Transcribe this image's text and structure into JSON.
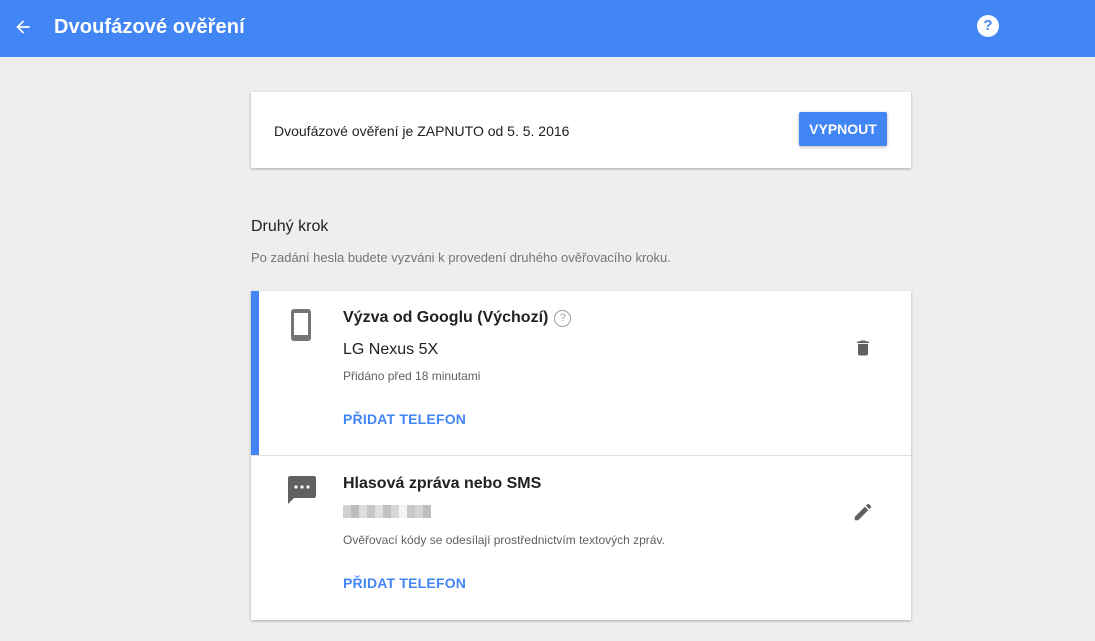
{
  "appbar": {
    "title": "Dvoufázové ověření",
    "back_icon": "arrow-back-icon",
    "help_icon": "help-icon",
    "help_glyph": "?",
    "color": "#4285f4"
  },
  "status": {
    "text": "Dvoufázové ověření je ZAPNUTO od 5. 5. 2016",
    "button_label": "VYPNOUT"
  },
  "second_step": {
    "title": "Druhý krok",
    "description": "Po zadání hesla budete vyzváni k provedení druhého ověřovacího kroku."
  },
  "methods": [
    {
      "icon": "smartphone-icon",
      "title_prefix": "Výzva od Googlu (",
      "title_default": "Výchozí",
      "title_suffix": ")",
      "help_glyph": "?",
      "device": "LG Nexus 5X",
      "detail": "Přidáno před 18 minutami",
      "link": "PŘIDAT TELEFON",
      "action_icon": "delete-icon",
      "active": true
    },
    {
      "icon": "sms-icon",
      "title": "Hlasová zpráva nebo SMS",
      "detail": "Ověřovací kódy se odesílají prostřednictvím textových zpráv.",
      "link": "PŘIDAT TELEFON",
      "action_icon": "edit-icon",
      "active": false
    }
  ]
}
